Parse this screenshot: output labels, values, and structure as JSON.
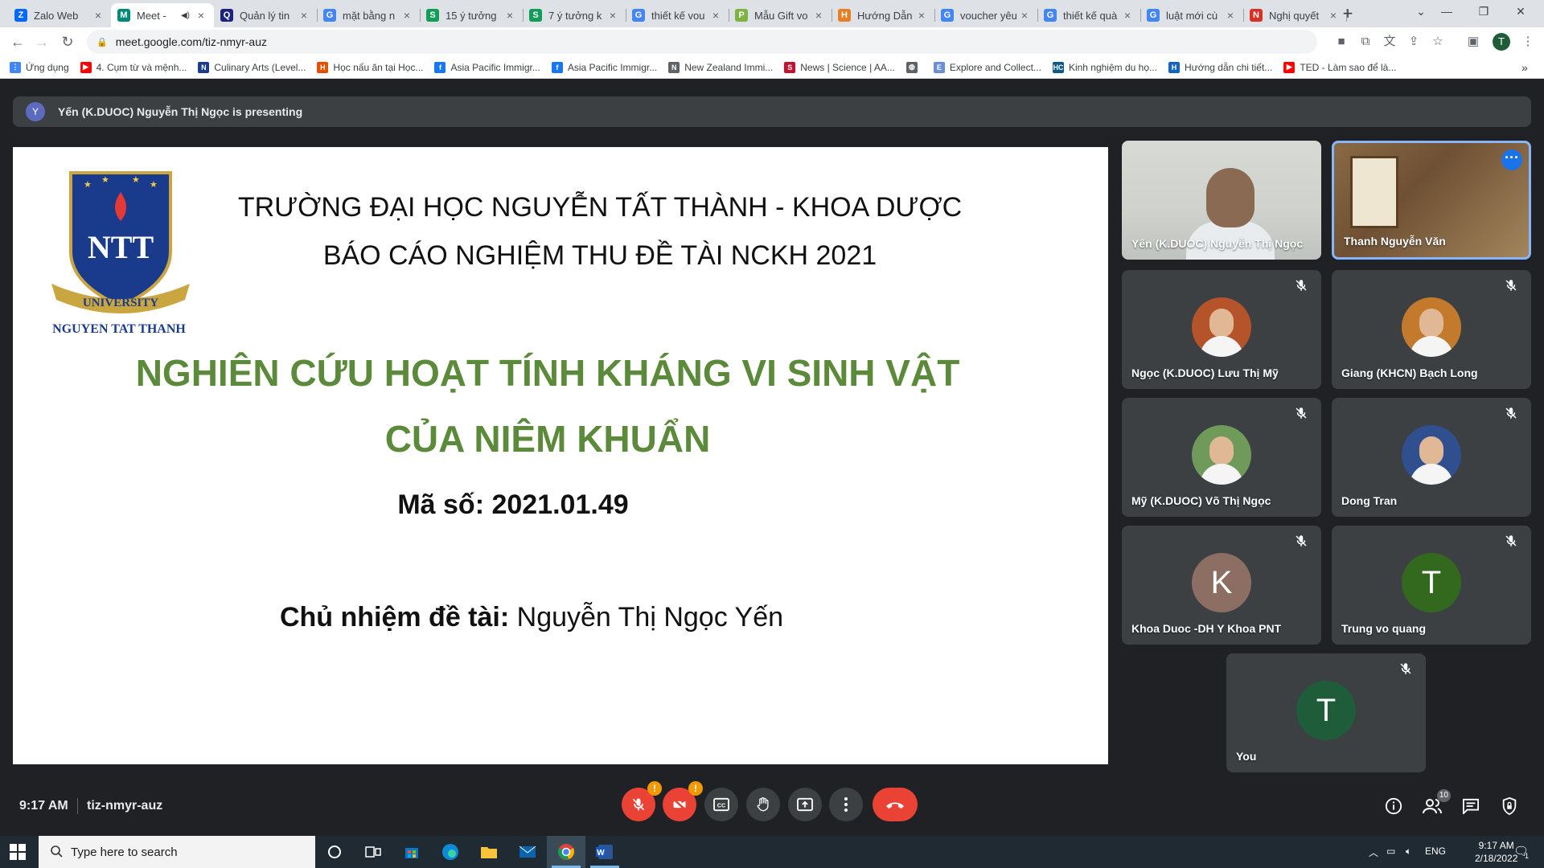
{
  "browser": {
    "tabs": [
      {
        "title": "Zalo Web",
        "favicon_color": "#0068ff",
        "favicon_letter": "Z",
        "active": false
      },
      {
        "title": "Meet -",
        "favicon_color": "#00897b",
        "favicon_letter": "M",
        "active": true,
        "audio": true
      },
      {
        "title": "Quản lý tin",
        "favicon_color": "#1a237e",
        "favicon_letter": "Q",
        "active": false
      },
      {
        "title": "mặt bằng n",
        "favicon_color": "#4285f4",
        "favicon_letter": "G",
        "active": false
      },
      {
        "title": "15 ý tưởng",
        "favicon_color": "#0f9d58",
        "favicon_letter": "S",
        "active": false
      },
      {
        "title": "7 ý tưởng k",
        "favicon_color": "#0f9d58",
        "favicon_letter": "S",
        "active": false
      },
      {
        "title": "thiết kế vou",
        "favicon_color": "#4285f4",
        "favicon_letter": "G",
        "active": false
      },
      {
        "title": "Mẫu Gift vo",
        "favicon_color": "#7cb342",
        "favicon_letter": "P",
        "active": false
      },
      {
        "title": "Hướng Dẫn",
        "favicon_color": "#e67e22",
        "favicon_letter": "H",
        "active": false
      },
      {
        "title": "voucher yêu",
        "favicon_color": "#4285f4",
        "favicon_letter": "G",
        "active": false
      },
      {
        "title": "thiết kế quà",
        "favicon_color": "#4285f4",
        "favicon_letter": "G",
        "active": false
      },
      {
        "title": "luật mới cù",
        "favicon_color": "#4285f4",
        "favicon_letter": "G",
        "active": false
      },
      {
        "title": "Nghị quyết",
        "favicon_color": "#d93025",
        "favicon_letter": "N",
        "active": false
      }
    ],
    "url": "meet.google.com/tiz-nmyr-auz",
    "profile_letter": "T",
    "bookmarks": [
      {
        "label": "Ứng dụng",
        "color": "#4285f4",
        "letter": "⋮"
      },
      {
        "label": "4. Cụm từ và mệnh...",
        "color": "#ff0000",
        "letter": "▶"
      },
      {
        "label": "Culinary Arts (Level...",
        "color": "#1a3e8c",
        "letter": "N"
      },
      {
        "label": "Học nấu ăn tại Học...",
        "color": "#e65100",
        "letter": "H"
      },
      {
        "label": "Asia Pacific Immigr...",
        "color": "#1877f2",
        "letter": "f"
      },
      {
        "label": "Asia Pacific Immigr...",
        "color": "#1877f2",
        "letter": "f"
      },
      {
        "label": "New Zealand Immi...",
        "color": "#5f6368",
        "letter": "N"
      },
      {
        "label": "News | Science | AA...",
        "color": "#c41230",
        "letter": "S"
      },
      {
        "label": "",
        "color": "#5f6368",
        "letter": "◍"
      },
      {
        "label": "Explore and Collect...",
        "color": "#6a8fd8",
        "letter": "E"
      },
      {
        "label": "Kinh nghiệm du họ...",
        "color": "#0b5a8a",
        "letter": "HC"
      },
      {
        "label": "Hướng dẫn chi tiết...",
        "color": "#1565c0",
        "letter": "H"
      },
      {
        "label": "TED - Làm sao để là...",
        "color": "#ff0000",
        "letter": "▶"
      }
    ]
  },
  "meet": {
    "presenting_text": "Yến (K.DUOC) Nguyễn Thị Ngọc is presenting",
    "presenter_initial": "Y",
    "slide": {
      "logo_text": "NGUYEN TAT THANH",
      "logo_ribbon": "UNIVERSITY",
      "logo_mark": "NTT",
      "header_line1": "TRƯỜNG ĐẠI HỌC NGUYỄN TẤT THÀNH - KHOA DƯỢC",
      "header_line2": "BÁO CÁO NGHIỆM THU ĐỀ TÀI NCKH 2021",
      "title_line1": "NGHIÊN CỨU HOẠT TÍNH KHÁNG VI SINH VẬT",
      "title_line2": "CỦA NIÊM KHUẨN",
      "code": "Mã số: 2021.01.49",
      "lead_label": "Chủ nhiệm đề tài:",
      "lead_name": "Nguyễn Thị Ngọc Yến"
    },
    "participants": [
      {
        "name": "Yến (K.DUOC) Nguyễn Thị Ngọc",
        "kind": "video",
        "muted": false
      },
      {
        "name": "Thanh Nguyễn Văn",
        "kind": "video",
        "muted": false,
        "highlighted": true
      },
      {
        "name": "Ngọc (K.DUOC) Lưu Thị Mỹ",
        "kind": "photo",
        "muted": true,
        "color": "#b5542a"
      },
      {
        "name": "Giang (KHCN) Bạch Long",
        "kind": "photo",
        "muted": true,
        "color": "#c47a2c"
      },
      {
        "name": "Mỹ (K.DUOC) Võ Thị Ngọc",
        "kind": "photo",
        "muted": true,
        "color": "#6f9a5a"
      },
      {
        "name": "Dong Tran",
        "kind": "photo",
        "muted": true,
        "color": "#2f4f8f"
      },
      {
        "name": "Khoa Duoc -DH Y Khoa PNT",
        "kind": "initial",
        "initial": "K",
        "color": "#8d6e63",
        "muted": true
      },
      {
        "name": "Trung vo quang",
        "kind": "initial",
        "initial": "T",
        "color": "#33691e",
        "muted": true
      },
      {
        "name": "You",
        "kind": "initial",
        "initial": "T",
        "color": "#1e5c3a",
        "muted": true
      }
    ],
    "bottom": {
      "time": "9:17 AM",
      "meeting_code": "tiz-nmyr-auz",
      "participant_count": "10"
    }
  },
  "taskbar": {
    "search_placeholder": "Type here to search",
    "language": "ENG",
    "time": "9:17 AM",
    "date": "2/18/2022",
    "notifications": "1"
  }
}
